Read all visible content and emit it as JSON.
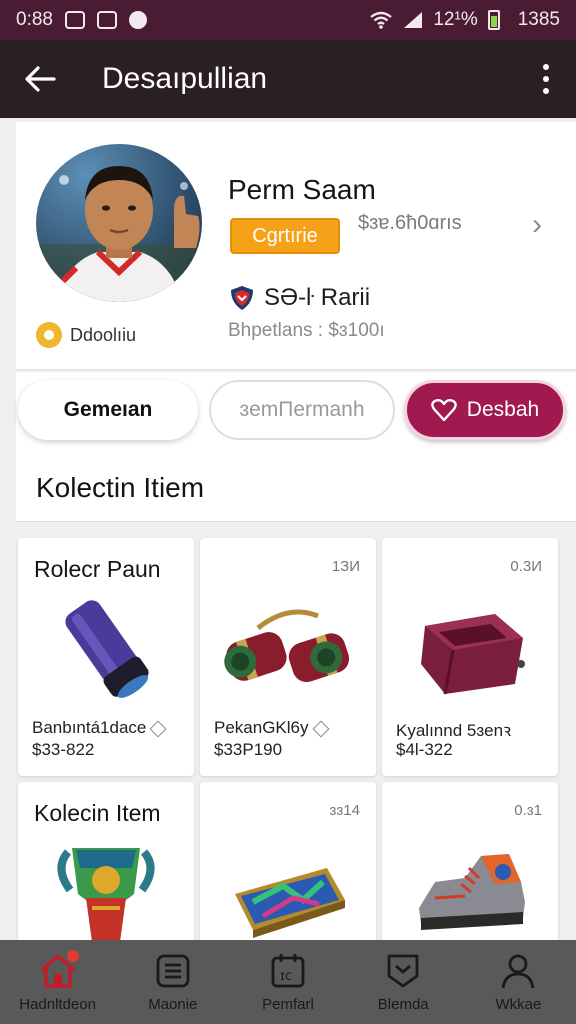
{
  "status_bar": {
    "time": "0:88",
    "battery_pct": "12¹%",
    "clock_right": "1385"
  },
  "app_bar": {
    "title": "Desaıpullian",
    "back_icon": "arrow-left-icon",
    "more_icon": "more-vertical-icon"
  },
  "profile": {
    "name": "Perm Saam",
    "status_label": "Cgrtırie",
    "price": "$ɜɐ.6ħ0ɑrıs",
    "team": "SƏ-ŀ Rarii",
    "meta": "Bhpetlans : $ɜ100ı",
    "badge_label": "Ddoolıiu"
  },
  "actions": {
    "primary": "Gemeıan",
    "secondary": "ɜemПermanh",
    "favorite": "Desbah"
  },
  "collection": {
    "title": "Kolectin Itiem",
    "items": [
      {
        "title": "Rolecr Paun",
        "count": "",
        "name": "Banbıntá1dace",
        "price": "$33-822",
        "image": "scope-tube"
      },
      {
        "title": "",
        "count": "1ЗИ",
        "name": "PekanGKl6y",
        "price": "$33P190",
        "image": "binoculars"
      },
      {
        "title": "",
        "count": "0.3И",
        "name": "Kyalınnd 5ɜenꝛ",
        "price": "$4l-322",
        "image": "bag"
      },
      {
        "title": "Kolecin Item",
        "count": "",
        "name": "",
        "price": "",
        "image": "trophy"
      },
      {
        "title": "",
        "count": "ɜɜ14",
        "name": "",
        "price": "",
        "image": "chest"
      },
      {
        "title": "",
        "count": "0.ɜ1",
        "name": "",
        "price": "",
        "image": "sneaker"
      }
    ]
  },
  "bottom_nav": [
    {
      "label": "Hadnltdeon",
      "icon": "home-icon"
    },
    {
      "label": "Maonie",
      "icon": "list-icon"
    },
    {
      "label": "Pemfarl",
      "icon": "gallery-icon"
    },
    {
      "label": "Blemda",
      "icon": "badge-icon"
    },
    {
      "label": "Wkkae",
      "icon": "profile-icon"
    }
  ],
  "colors": {
    "status_bar": "#4a1c34",
    "app_bar": "#2a2024",
    "accent": "#a0194f",
    "status_pill": "#f6a219",
    "bottom_nav": "#595959"
  }
}
